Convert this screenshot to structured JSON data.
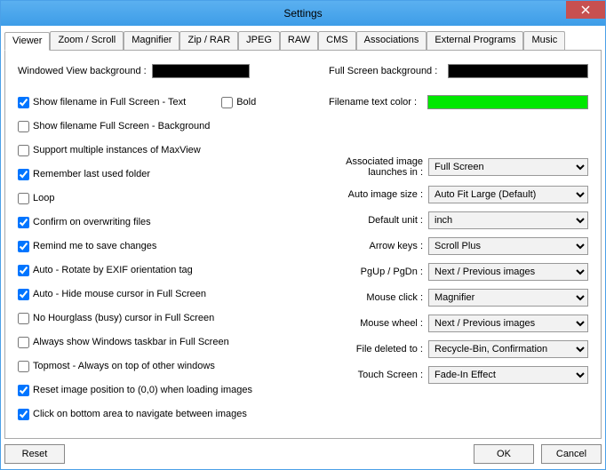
{
  "window": {
    "title": "Settings"
  },
  "tabs": [
    "Viewer",
    "Zoom / Scroll",
    "Magnifier",
    "Zip / RAR",
    "JPEG",
    "RAW",
    "CMS",
    "Associations",
    "External Programs",
    "Music"
  ],
  "left": {
    "windowed_bg_label": "Windowed View background :",
    "windowed_bg_color": "#000000",
    "show_filename_text": "Show filename in Full Screen - Text",
    "bold": "Bold",
    "show_filename_bg": "Show filename Full Screen - Background",
    "multi_instance": "Support multiple instances of MaxView",
    "remember_folder": "Remember last used folder",
    "loop": "Loop",
    "confirm_overwrite": "Confirm on overwriting files",
    "remind_save": "Remind me to save changes",
    "auto_rotate": "Auto - Rotate by EXIF orientation tag",
    "auto_hide_cursor": "Auto - Hide mouse cursor in Full Screen",
    "no_hourglass": "No Hourglass (busy) cursor in Full Screen",
    "always_taskbar": "Always show Windows taskbar in Full Screen",
    "topmost": "Topmost - Always on top of other windows",
    "reset_pos": "Reset image position to (0,0) when loading images",
    "click_bottom": "Click on bottom area to navigate between images"
  },
  "right": {
    "fullscreen_bg_label": "Full Screen background :",
    "fullscreen_bg_color": "#000000",
    "filename_color_label": "Filename text color :",
    "filename_color": "#00e800",
    "assoc_launch_label": "Associated image launches in :",
    "assoc_launch_value": "Full Screen",
    "auto_size_label": "Auto image size :",
    "auto_size_value": "Auto Fit Large (Default)",
    "default_unit_label": "Default unit :",
    "default_unit_value": "inch",
    "arrow_keys_label": "Arrow keys :",
    "arrow_keys_value": "Scroll Plus",
    "pgup_label": "PgUp / PgDn :",
    "pgup_value": "Next / Previous images",
    "mouse_click_label": "Mouse click :",
    "mouse_click_value": "Magnifier",
    "mouse_wheel_label": "Mouse wheel :",
    "mouse_wheel_value": "Next / Previous images",
    "file_deleted_label": "File deleted to :",
    "file_deleted_value": "Recycle-Bin, Confirmation",
    "touch_label": "Touch Screen :",
    "touch_value": "Fade-In Effect"
  },
  "buttons": {
    "reset": "Reset",
    "ok": "OK",
    "cancel": "Cancel"
  }
}
